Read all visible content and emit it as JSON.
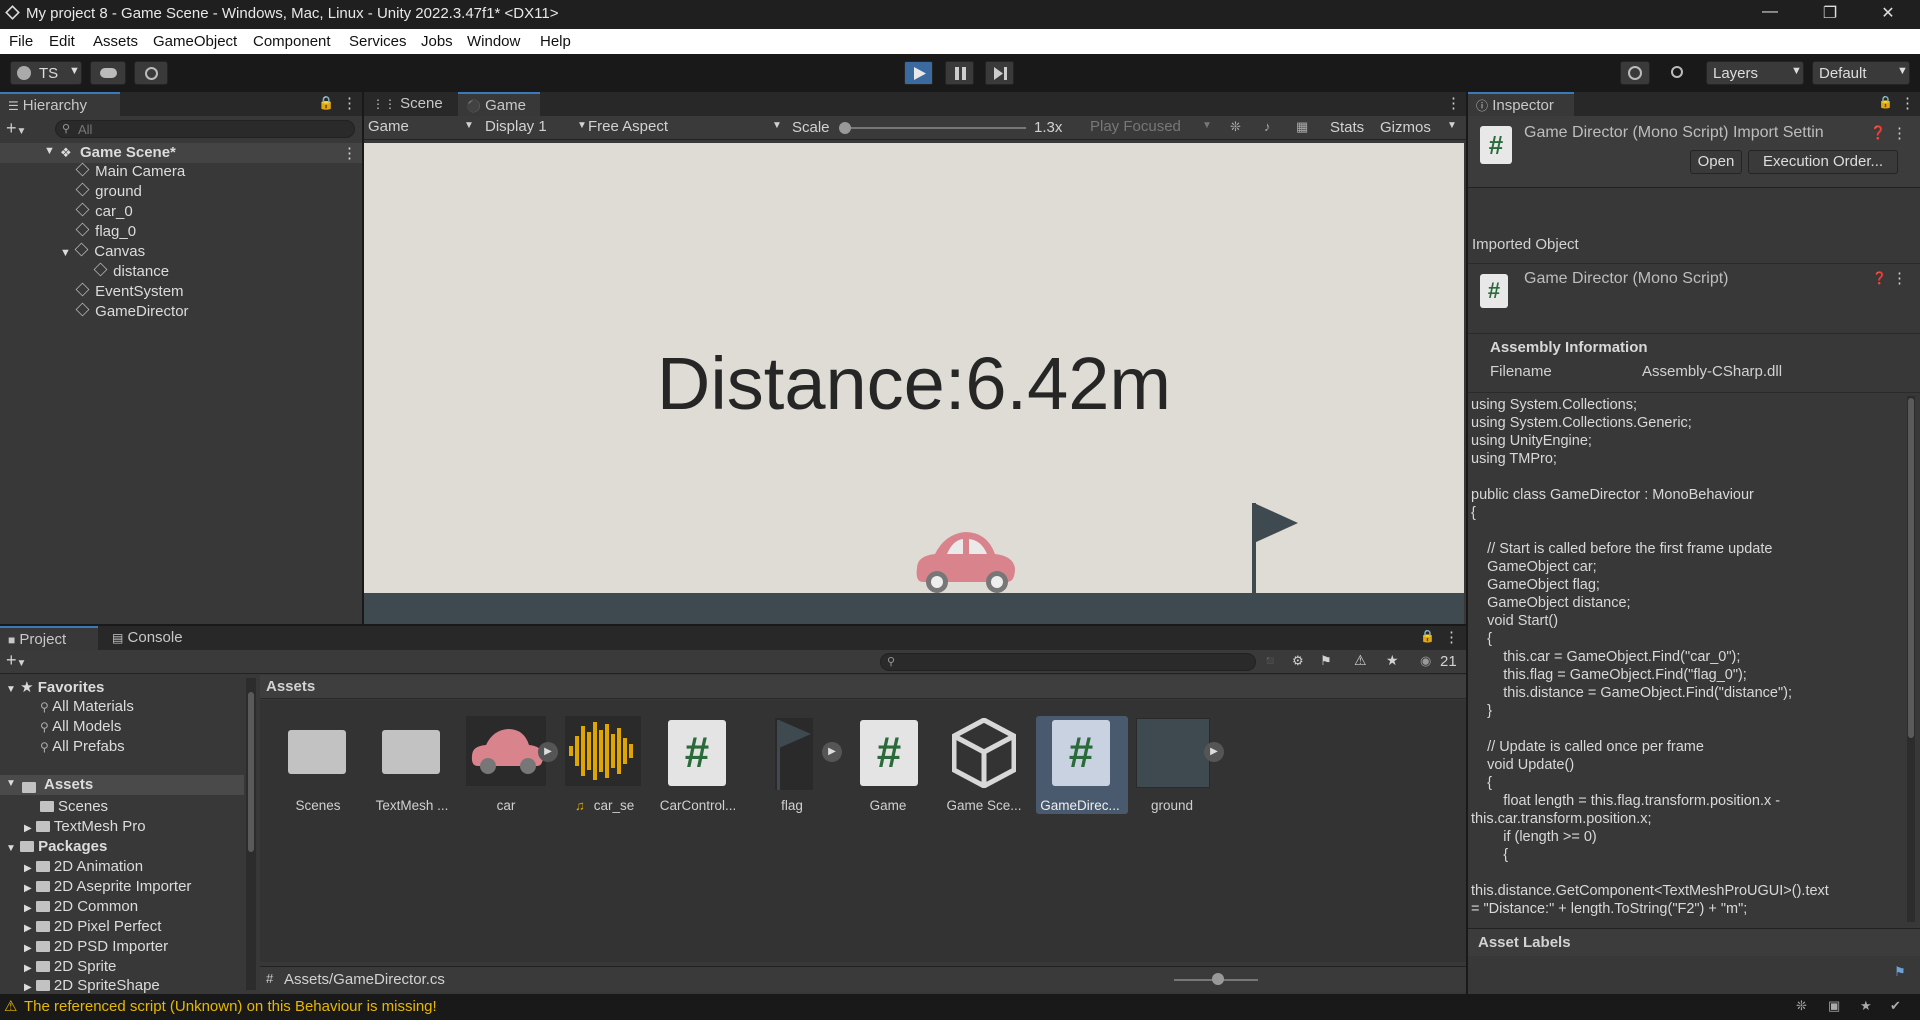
{
  "window": {
    "title": "My project 8 - Game Scene - Windows, Mac, Linux - Unity 2022.3.47f1* <DX11>"
  },
  "menu": [
    "File",
    "Edit",
    "Assets",
    "GameObject",
    "Component",
    "Services",
    "Jobs",
    "Window",
    "Help"
  ],
  "toolbar": {
    "account": "TS",
    "layers": "Layers",
    "layout": "Default"
  },
  "hierarchy": {
    "tab": "Hierarchy",
    "search_placeholder": "All",
    "scene": "Game Scene*",
    "items": [
      "Main Camera",
      "ground",
      "car_0",
      "flag_0",
      "Canvas",
      "distance",
      "EventSystem",
      "GameDirector"
    ]
  },
  "game_view": {
    "tabs": [
      "Scene",
      "Game"
    ],
    "mode": "Game",
    "display": "Display 1",
    "aspect": "Free Aspect",
    "scale_label": "Scale",
    "scale_value": "1.3x",
    "play_mode": "Play Focused",
    "stats": "Stats",
    "gizmos": "Gizmos",
    "distance_text": "Distance:6.42m"
  },
  "inspector": {
    "tab": "Inspector",
    "header_title": "Game Director (Mono Script) Import Settin",
    "open_btn": "Open",
    "exec_btn": "Execution Order...",
    "imported_object": "Imported Object",
    "object_name": "Game Director (Mono Script)",
    "assembly_title": "Assembly Information",
    "filename_label": "Filename",
    "filename_value": "Assembly-CSharp.dll",
    "code_lines": [
      "using System.Collections;",
      "using System.Collections.Generic;",
      "using UnityEngine;",
      "using TMPro;",
      "",
      "public class GameDirector : MonoBehaviour",
      "{",
      "",
      "    // Start is called before the first frame update",
      "    GameObject car;",
      "    GameObject flag;",
      "    GameObject distance;",
      "    void Start()",
      "    {",
      "        this.car = GameObject.Find(\"car_0\");",
      "        this.flag = GameObject.Find(\"flag_0\");",
      "        this.distance = GameObject.Find(\"distance\");",
      "    }",
      "",
      "    // Update is called once per frame",
      "    void Update()",
      "    {",
      "        float length = this.flag.transform.position.x -",
      "this.car.transform.position.x;",
      "        if (length >= 0)",
      "        {",
      "",
      "this.distance.GetComponent<TextMeshProUGUI>().text",
      "= \"Distance:\" + length.ToString(\"F2\") + \"m\";"
    ],
    "asset_labels": "Asset Labels"
  },
  "project": {
    "tabs": [
      "Project",
      "Console"
    ],
    "count": "21",
    "favorites_title": "Favorites",
    "favorites": [
      "All Materials",
      "All Models",
      "All Prefabs"
    ],
    "assets_title": "Assets",
    "asset_folders": [
      "Scenes",
      "TextMesh Pro"
    ],
    "packages_title": "Packages",
    "packages": [
      "2D Animation",
      "2D Aseprite Importer",
      "2D Common",
      "2D Pixel Perfect",
      "2D PSD Importer",
      "2D Sprite",
      "2D SpriteShape"
    ],
    "breadcrumb": "Assets",
    "grid_items": [
      "Scenes",
      "TextMesh ...",
      "car",
      "car_se",
      "CarControl...",
      "flag",
      "Game",
      "Game Sce...",
      "GameDirec...",
      "ground"
    ],
    "path": "Assets/GameDirector.cs"
  },
  "status": {
    "message": "The referenced script (Unknown) on this Behaviour is missing!"
  },
  "colors": {
    "accent": "#3a79bb",
    "game_bg": "#dedcd4",
    "ground": "#3e4a4f",
    "car": "#d9848c",
    "warning": "#e6b800"
  }
}
